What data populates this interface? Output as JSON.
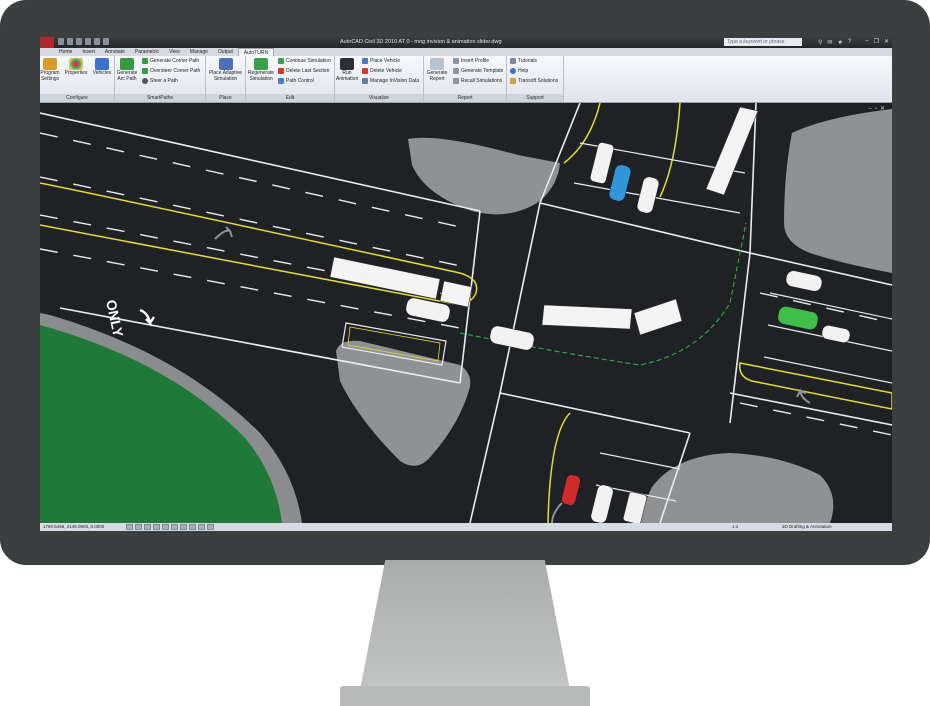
{
  "window": {
    "title": "AutoCAD Civil 3D 2010    AT 0 - mng invision & animation slider.dwg",
    "search_placeholder": "Type a keyword or phrase"
  },
  "tabs": [
    {
      "label": "Home"
    },
    {
      "label": "Insert"
    },
    {
      "label": "Annotate"
    },
    {
      "label": "Parametric"
    },
    {
      "label": "View"
    },
    {
      "label": "Manage"
    },
    {
      "label": "Output"
    },
    {
      "label": "AutoTURN",
      "active": true
    }
  ],
  "ribbon": {
    "configure": {
      "title": "Configure",
      "program_settings": "Program Settings",
      "properties": "Properties",
      "vehicles": "Vehicles"
    },
    "smartpaths": {
      "title": "SmartPaths",
      "generate_arc_path": "Generate Arc Path",
      "generate_corner_path": "Generate Corner Path",
      "oversteer_corner_path": "Oversteer Corner Path",
      "steer_a_path": "Steer a Path"
    },
    "place": {
      "title": "Place",
      "place_adaptive_simulation": "Place Adaptive Simulation"
    },
    "edit": {
      "title": "Edit",
      "regenerate_simulation": "Regenerate Simulation",
      "continue_simulation": "Continue Simulation",
      "delete_last_section": "Delete Last Section",
      "path_control": "Path Control"
    },
    "visualize": {
      "title": "Visualize",
      "run_animation": "Run Animation",
      "place_vehicle": "Place Vehicle",
      "delete_vehicle": "Delete Vehicle",
      "manage_invision_data": "Manage InVision Data"
    },
    "report": {
      "title": "Report",
      "generate_report": "Generate Report",
      "insert_profile": "Insert Profile",
      "generate_template": "Generate Template",
      "recall_simulations": "Recall Simulations"
    },
    "support": {
      "title": "Support",
      "tutorials": "Tutorials",
      "help": "Help",
      "transoft_solutions": "Transoft Solutions"
    }
  },
  "drawing": {
    "road_marking": "ONLY"
  },
  "status": {
    "coordinates": "1760.5456, 2146.0503, 0.0000",
    "scale": "1:1",
    "workspace": "2D Drafting & Annotation"
  },
  "colors": {
    "road": "#1f2124",
    "island": "#8f9193",
    "grass": "#1f7a3a",
    "lane_white": "#e9ecef",
    "lane_yellow": "#e3dc3a",
    "path_green": "#2aa34a",
    "car_blue": "#2f97d8",
    "car_red": "#d12a2a",
    "car_green": "#3fbf4a"
  }
}
